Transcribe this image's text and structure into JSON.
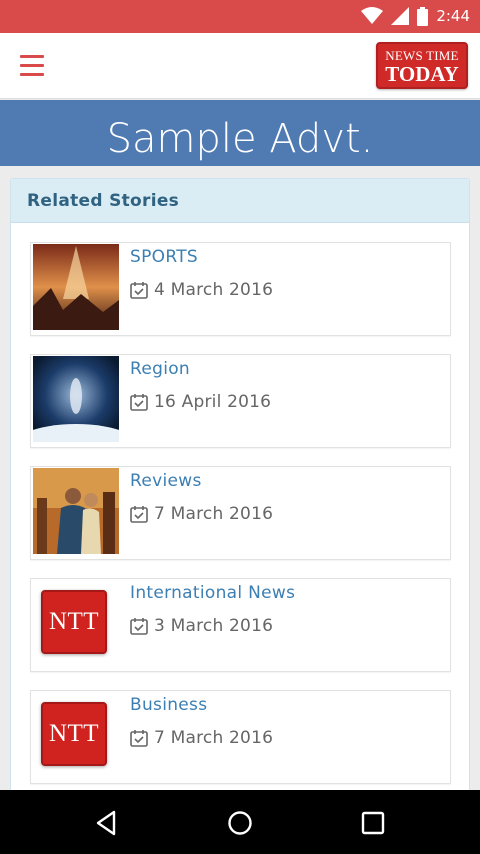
{
  "status_bar": {
    "time": "2:44",
    "icons": [
      "wifi-icon",
      "signal-icon",
      "battery-icon"
    ],
    "background": "#d94a4a"
  },
  "app_bar": {
    "menu_icon": "hamburger-menu-icon",
    "logo_line1": "NEWS TIME",
    "logo_line2": "TODAY",
    "accent": "#d94a4a"
  },
  "ad_banner": {
    "text": "Sample Advt.",
    "background": "#4f7ab2"
  },
  "related": {
    "header": "Related Stories",
    "stories": [
      {
        "title": "SPORTS",
        "date": "4 March 2016",
        "thumb": "sports-thumbnail"
      },
      {
        "title": "Region",
        "date": "16 April 2016",
        "thumb": "region-thumbnail"
      },
      {
        "title": "Reviews",
        "date": "7 March 2016",
        "thumb": "reviews-thumbnail"
      },
      {
        "title": "International News",
        "date": "3 March 2016",
        "thumb": "ntt-logo",
        "logo_text": "NTT"
      },
      {
        "title": "Business",
        "date": "7 March 2016",
        "thumb": "ntt-logo",
        "logo_text": "NTT"
      }
    ]
  },
  "nav_bar": {
    "icons": [
      "back-icon",
      "home-icon",
      "recents-icon"
    ]
  }
}
